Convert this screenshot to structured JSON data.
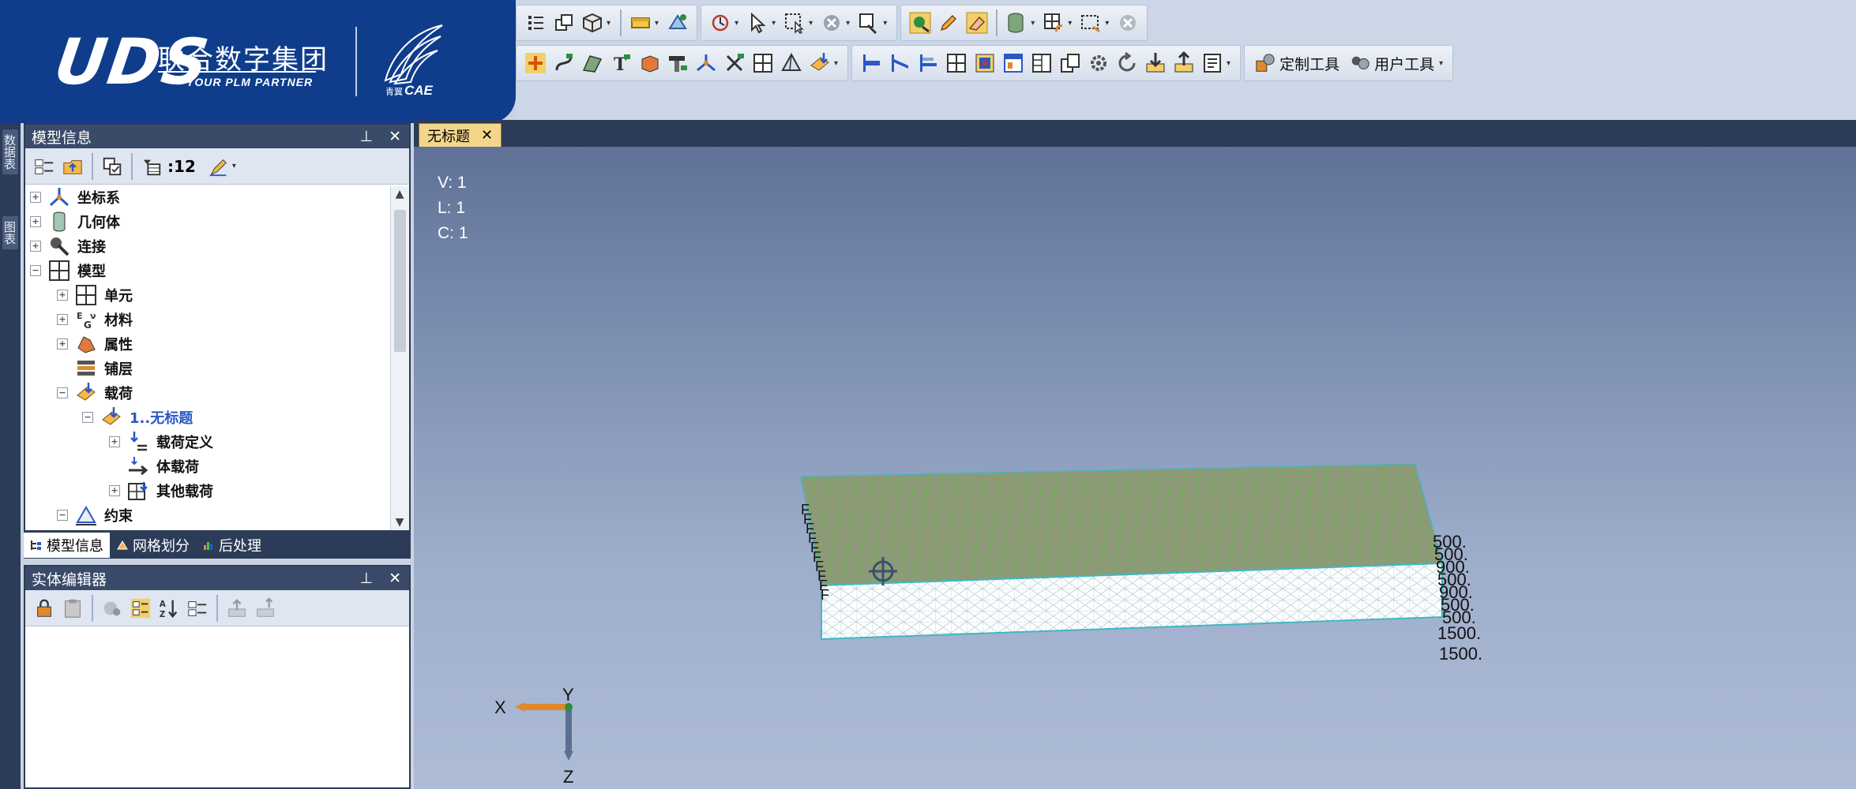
{
  "brand": {
    "logo": "UDS",
    "company": "联合数字集团",
    "tagline": "YOUR PLM PARTNER",
    "product_prefix": "青翼",
    "product": "CAE"
  },
  "toolbar": {
    "custom_tools": "定制工具",
    "user_tools": "用户工具"
  },
  "side_tabs": [
    "数据表",
    "图表"
  ],
  "model_panel": {
    "title": "模型信息",
    "count": ":12",
    "tree": [
      {
        "label": "坐标系"
      },
      {
        "label": "几何体"
      },
      {
        "label": "连接"
      },
      {
        "label": "模型"
      },
      {
        "label": "单元"
      },
      {
        "label": "材料"
      },
      {
        "label": "属性"
      },
      {
        "label": "铺层"
      },
      {
        "label": "载荷"
      },
      {
        "label": "1..无标题"
      },
      {
        "label": "载荷定义"
      },
      {
        "label": "体载荷"
      },
      {
        "label": "其他载荷"
      },
      {
        "label": "约束"
      }
    ],
    "tabs": [
      "模型信息",
      "网格划分",
      "后处理"
    ]
  },
  "entity_panel": {
    "title": "实体编辑器"
  },
  "document": {
    "tab_title": "无标题"
  },
  "viewport": {
    "stats": [
      "V: 1",
      "L: 1",
      "C: 1"
    ],
    "load_labels": [
      "500.",
      "500.",
      "900.",
      "500.",
      "900.",
      "500.",
      "500.",
      "1500.",
      "1500."
    ],
    "axes": {
      "x": "X",
      "y": "Y",
      "z": "Z"
    },
    "colors": {
      "top_face": "#8d9a78",
      "side_face": "#ffffff",
      "mesh_line": "#3fb8c4",
      "load_arrow": "#52c23a"
    }
  }
}
